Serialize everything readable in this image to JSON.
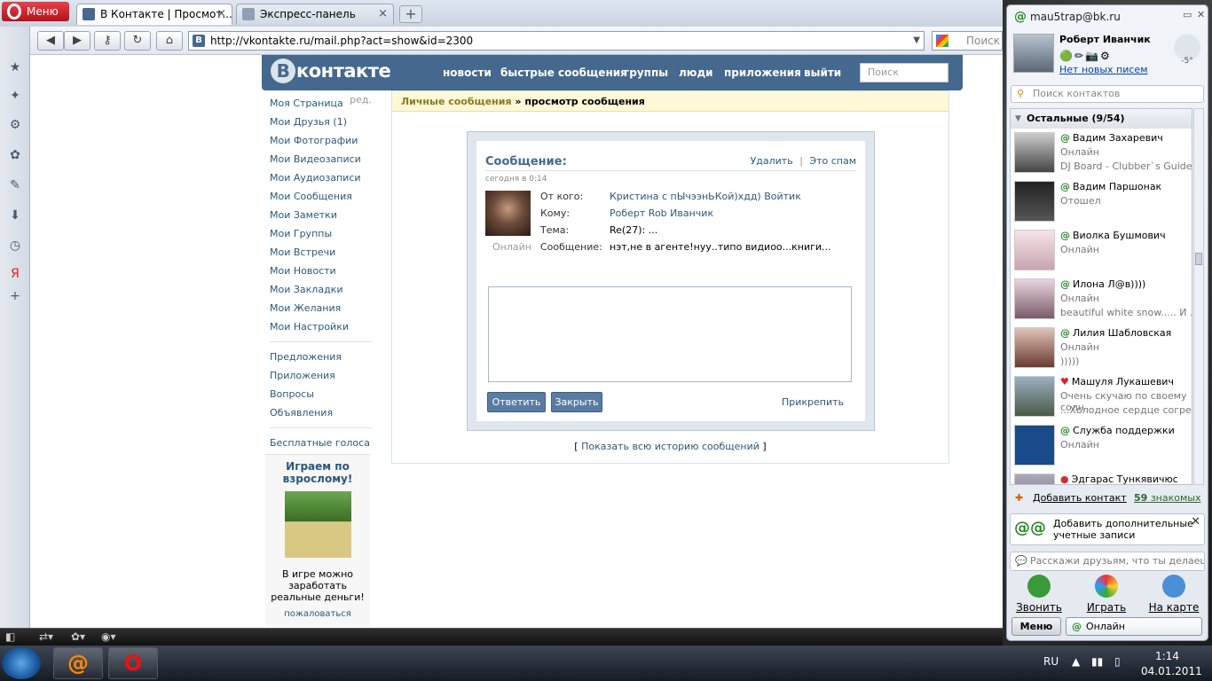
{
  "opera": {
    "menu_label": "Меню",
    "tabs": [
      {
        "label": "В Контакте | Просмот...",
        "active": true
      },
      {
        "label": "Экспресс-панель",
        "active": false
      }
    ],
    "url": "http://vkontakte.ru/mail.php?act=show&id=2300",
    "search_placeholder": "Поиск в"
  },
  "vk": {
    "logo": "контакте",
    "logo_letter": "В",
    "nav": [
      "новости",
      "быстрые сообщения",
      "группы",
      "люди",
      "приложения",
      "выйти"
    ],
    "search_placeholder": "Поиск",
    "left_menu": [
      "Моя Страница",
      "Мои Друзья (1)",
      "Мои Фотографии",
      "Мои Видеозаписи",
      "Мои Аудиозаписи",
      "Мои Сообщения",
      "Мои Заметки",
      "Мои Группы",
      "Мои Встречи",
      "Мои Новости",
      "Мои Закладки",
      "Мои Желания",
      "Мои Настройки"
    ],
    "edit_label": "ред.",
    "left_menu2": [
      "Предложения",
      "Приложения",
      "Вопросы",
      "Объявления"
    ],
    "left_menu3": [
      "Бесплатные голоса"
    ],
    "ad": {
      "title": "Играем по взрослому!",
      "text": "В игре можно заработать реальные деньги!",
      "complain": "пожаловаться"
    },
    "breadcrumb_link": "Личные сообщения",
    "breadcrumb_current": "» просмотр сообщения",
    "message": {
      "title": "Сообщение:",
      "delete": "Удалить",
      "sep": "|",
      "spam": "Это спам",
      "date": "сегодня в 0:14",
      "online": "Онлайн",
      "from_label": "От кого:",
      "from_value": "Кристина с пЫчээнЬКой)хдд) Войтик",
      "to_label": "Кому:",
      "to_value": "Роберт Rob Иванчик",
      "subject_label": "Тема:",
      "subject_value": "Re(27): ...",
      "body_label": "Сообщение:",
      "body_value": "нэт,не в агенте!нуу..типо видиоо...книги...",
      "reply_button": "Ответить",
      "close_button": "Закрыть",
      "attach": "Прикрепить"
    },
    "history_open": "[",
    "history_link": "Показать всю историю сообщений",
    "history_close": "]"
  },
  "agent": {
    "account": "mau5trap@bk.ru",
    "user_name": "Роберт Иванчик",
    "no_mail": "Нет новых писем",
    "weather": "-5°",
    "search_placeholder": "Поиск контактов",
    "group": "Остальные (9/54)",
    "contacts": [
      {
        "name": "Вадим Захаревич",
        "status": "Онлайн",
        "extra": "DJ Board - Clubber`s Guide"
      },
      {
        "name": "Вадим Паршонак",
        "status": "Отошел",
        "extra": ""
      },
      {
        "name": "Виолка Бушмович",
        "status": "Онлайн",
        "extra": ""
      },
      {
        "name": "Илона Л@в))))",
        "status": "Онлайн",
        "extra": "beautiful white snow..... И ..."
      },
      {
        "name": "Лилия Шабловская",
        "status": "Онлайн",
        "extra": ")))))"
      },
      {
        "name": "Машуля Лукашевич",
        "status": "Очень скучаю по своему солн",
        "extra": "...Холодное сердце согрее"
      },
      {
        "name": "Служба поддержки",
        "status": "Онлайн",
        "extra": ""
      },
      {
        "name": "Эдгарас Тункявичюс",
        "status": "",
        "extra": ""
      }
    ],
    "add_contact": "Добавить контакт",
    "acquaintances_count": "59",
    "acquaintances_label": "знакомых",
    "promo": "Добавить дополнительные учетные записи",
    "tell_friends": "Расскажи друзьям, что ты делаешь...",
    "actions": [
      "Звонить",
      "Играть",
      "На карте"
    ],
    "menu": "Меню",
    "status": "Онлайн"
  },
  "taskbar": {
    "lang": "RU",
    "time": "1:14",
    "date": "04.01.2011"
  }
}
